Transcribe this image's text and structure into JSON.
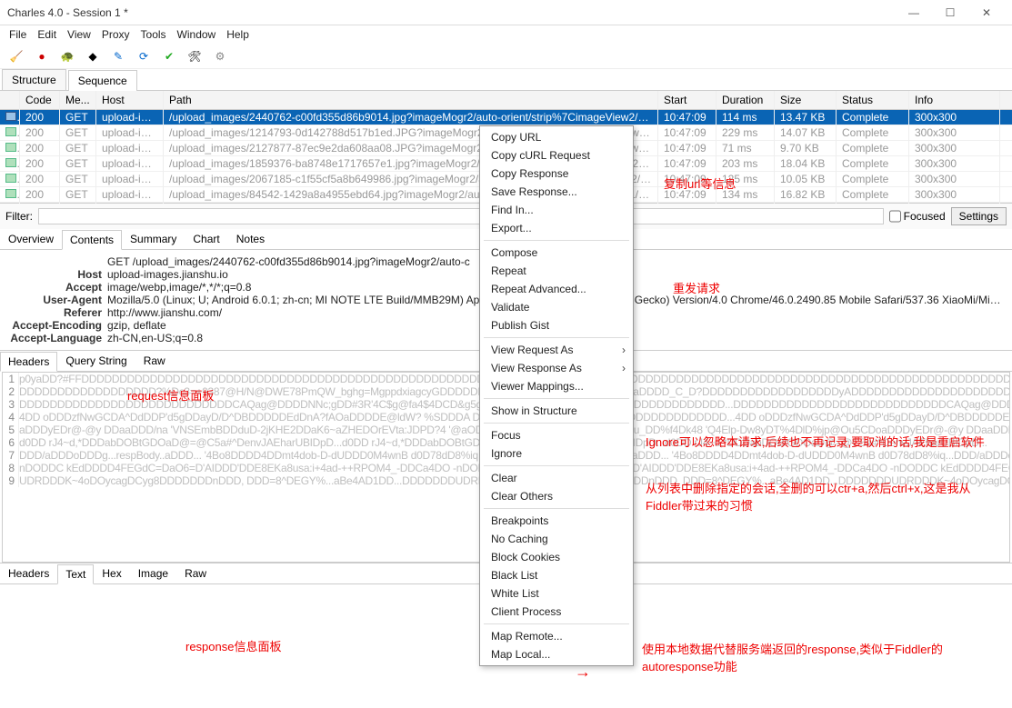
{
  "window": {
    "title": "Charles 4.0 - Session 1 *"
  },
  "menu": [
    "File",
    "Edit",
    "View",
    "Proxy",
    "Tools",
    "Window",
    "Help"
  ],
  "views": {
    "structure": "Structure",
    "sequence": "Sequence"
  },
  "cols": {
    "code": "Code",
    "me": "Me...",
    "host": "Host",
    "path": "Path",
    "start": "Start",
    "dur": "Duration",
    "size": "Size",
    "stat": "Status",
    "info": "Info"
  },
  "rows": [
    {
      "code": "200",
      "me": "GET",
      "host": "upload-im...",
      "path": "/upload_images/2440762-c00fd355d86b9014.jpg?imageMogr2/auto-orient/strip%7CimageView2/1/w...",
      "start": "10:47:09",
      "dur": "114 ms",
      "size": "13.47 KB",
      "stat": "Complete",
      "info": "300x300",
      "sel": true
    },
    {
      "code": "200",
      "me": "GET",
      "host": "upload-im...",
      "path": "/upload_images/1214793-0d142788d517b1ed.JPG?imageMogr2/auto-orient/strip%7CimageView2/1...",
      "start": "10:47:09",
      "dur": "229 ms",
      "size": "14.07 KB",
      "stat": "Complete",
      "info": "300x300"
    },
    {
      "code": "200",
      "me": "GET",
      "host": "upload-im...",
      "path": "/upload_images/2127877-87ec9e2da608aa08.JPG?imageMogr2/auto-orient/strip%7CimageView2/1...",
      "start": "10:47:09",
      "dur": "71 ms",
      "size": "9.70 KB",
      "stat": "Complete",
      "info": "300x300"
    },
    {
      "code": "200",
      "me": "GET",
      "host": "upload-im...",
      "path": "/upload_images/1859376-ba8748e1717657e1.jpg?imageMogr2/auto-orient/strip%7CimageView2/1/...",
      "start": "10:47:09",
      "dur": "203 ms",
      "size": "18.04 KB",
      "stat": "Complete",
      "info": "300x300"
    },
    {
      "code": "200",
      "me": "GET",
      "host": "upload-im...",
      "path": "/upload_images/2067185-c1f55cf5a8b649986.jpg?imageMogr2/auto-orient/strip%7CimageView2/1/w...",
      "start": "10:47:09",
      "dur": "125 ms",
      "size": "10.05 KB",
      "stat": "Complete",
      "info": "300x300"
    },
    {
      "code": "200",
      "me": "GET",
      "host": "upload-im...",
      "path": "/upload_images/84542-1429a8a4955ebd64.jpg?imageMogr2/auto-orient/strip%7CimageView2/1/w/3...",
      "start": "10:47:09",
      "dur": "134 ms",
      "size": "16.82 KB",
      "stat": "Complete",
      "info": "300x300"
    }
  ],
  "filter": {
    "label": "Filter:",
    "focused": "Focused",
    "settings": "Settings"
  },
  "detail_tabs": [
    "Overview",
    "Contents",
    "Summary",
    "Chart",
    "Notes"
  ],
  "detail_active": 1,
  "req_line": "GET /upload_images/2440762-c00fd355d86b9014.jpg?imageMogr2/auto-c",
  "headers": {
    "Host": "upload-images.jianshu.io",
    "Accept": "image/webp,image/*,*/*;q=0.8",
    "User-Agent": "Mozilla/5.0 (Linux; U; Android 6.0.1; zh-cn; MI NOTE LTE Build/MMB29M) AppleWebKit/537.36 (KHTML, like Gecko) Version/4.0 Chrome/46.0.2490.85 Mobile Safari/537.36 XiaoMi/Miui...",
    "Referer": "http://www.jianshu.com/",
    "Accept-Encoding": "gzip, deflate",
    "Accept-Language": "zh-CN,en-US;q=0.8"
  },
  "req_tabs": [
    "Headers",
    "Query String",
    "Raw"
  ],
  "resp_tabs": [
    "Headers",
    "Text",
    "Hex",
    "Image",
    "Raw"
  ],
  "ctx": [
    "Copy URL",
    "Copy cURL Request",
    "Copy Response",
    "Save Response...",
    "Find In...",
    "Export...",
    "-",
    "Compose",
    "Repeat",
    "Repeat Advanced...",
    "Validate",
    "Publish Gist",
    "-",
    "View Request As",
    "View Response As",
    "Viewer Mappings...",
    "-",
    "Show in Structure",
    "-",
    "Focus",
    "Ignore",
    "-",
    "Clear",
    "Clear Others",
    "-",
    "Breakpoints",
    "No Caching",
    "Block Cookies",
    "Black List",
    "White List",
    "Client Process",
    "-",
    "Map Remote...",
    "Map Local..."
  ],
  "ctx_sub": [
    "View Request As",
    "View Response As"
  ],
  "annots": {
    "copy": "复制url等信息",
    "repeat": "重发请求",
    "req_panel": "request信息面板",
    "ignore": "Ignore可以忽略本请求,后续也不再记录,要取消的话,我是重启软件",
    "clear": "从列表中删除指定的会话,全删的可以ctr+a,然后ctrl+x,这是我从Fiddler带过来的习惯",
    "resp_panel": "response信息面板",
    "map": "使用本地数据代替服务端返回的response,类似于Fiddler的autoresponse功能"
  },
  "body_lines": [
    "p0yaDD?#FFDDDDDDDDDDDDDDDDDDDDDDDDDDDDDDDDDDDDDDDDDDDDDDDDDDDDDDDDDDDDD",
    "DDDDDDDDDDDDDDDDDD?%Dc3=+9387@H/N@DWE78PmQW_bghg=MgppdxiagcyGDDDDDDD .......... hexdump placeholder yaDDDD_C_D?DDDDDDDDDDDDDDDDDDyADDDDDDDDDDDD",
    "DDDDDDDDDDDDDDDDDDDDDDDDDDDDCAQag@DDDDNNc;gDD#3R'4C$g@fa4$4DCD&g5g6HyA4..DD...DDDDDDDDDDDDDDDDDDDDDDDD...",
    "4DD oDDDzfNwGCDA^DdDDP'd5gDDayD/D^DBDDDDDEdDnA?fAOaDDDDE@ldW? %SDDDA DDDDDDDDDDDDD-DDDDDDDDDDDDDDDDDDDD...",
    "aDDDyEDr@-@y DDaaDDD/na 'VNSEmbBDDduD-2jKHE2DDaK6~aZHEDOrEVta:JDPD?4 '@aOD70  ^#@oOzZu  uDD=DDUW4 jx^u_DD%f4Dk48 'Q4Elp-Dw8yDT%4DlD%jp@Ou5CDo",
    "d0DD rJ4~d,*DDDabDOBtGDOaD@=@C5a#^DenvJAEharUBIDpD...",
    "DDD/aDDDoDDDg...respBody..aDDD... '4Bo8DDDD4DDmt4dob-D-dUDDD0M4wnB d0D78dD8%iq...",
    "nDODDC kEdDDDD4FEGdC=DaO6=D'AIDDD'DDE8EKa8usa:i+4ad-++RPOM4_-DDCa4DO  -",
    "UDRDDDK~4oDOycagDCyg8DDDDDDDnDDD, DDD=8^DEGY%...aBe4AD1DD...DDDDDDD"
  ]
}
